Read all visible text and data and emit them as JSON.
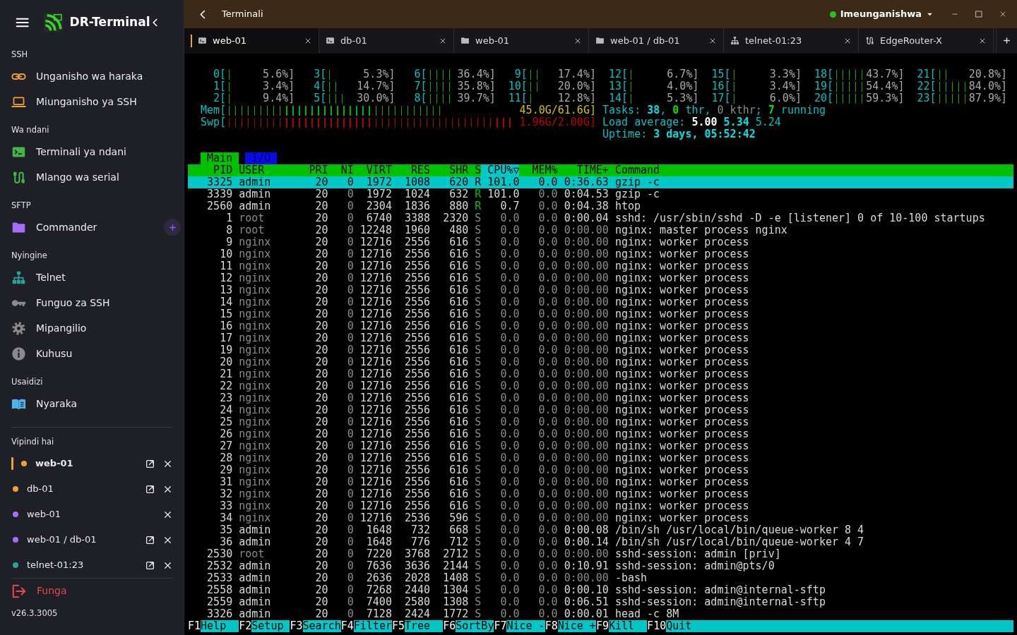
{
  "app": {
    "title": "DR-Terminal",
    "version": "v26.3.3005"
  },
  "sidebar": {
    "sections": [
      {
        "heading": "SSH",
        "items": [
          {
            "label": "Unganisho wa haraka",
            "addable": false
          },
          {
            "label": "Miunganisho ya SSH",
            "addable": false
          }
        ]
      },
      {
        "heading": "Wa ndani",
        "items": [
          {
            "label": "Terminali ya ndani",
            "addable": false
          },
          {
            "label": "Mlango wa serial",
            "addable": false
          }
        ]
      },
      {
        "heading": "SFTP",
        "items": [
          {
            "label": "Commander",
            "addable": true
          }
        ]
      },
      {
        "heading": "Nyingine",
        "items": [
          {
            "label": "Telnet",
            "addable": false
          },
          {
            "label": "Funguo za SSH",
            "addable": false
          },
          {
            "label": "Mipangilio",
            "addable": false
          },
          {
            "label": "Kuhusu",
            "addable": false
          }
        ]
      },
      {
        "heading": "Usaidizi",
        "items": [
          {
            "label": "Nyaraka",
            "addable": false
          }
        ]
      }
    ],
    "sessions_heading": "Vipindi hai",
    "sessions": [
      {
        "label": "web-01",
        "color": "#f0a030",
        "selected": true,
        "detachable": true
      },
      {
        "label": "db-01",
        "color": "#f0a030",
        "selected": false,
        "detachable": true
      },
      {
        "label": "web-01",
        "color": "#a66cff",
        "selected": false,
        "detachable": false
      },
      {
        "label": "web-01 / db-01",
        "color": "#a66cff",
        "selected": false,
        "detachable": true
      },
      {
        "label": "telnet-01:23",
        "color": "#26a69a",
        "selected": false,
        "detachable": true
      }
    ],
    "logout": "Funga"
  },
  "topbar": {
    "title": "Terminali",
    "status": "Imeunganishwa",
    "connected": true
  },
  "tabs": [
    {
      "label": "web-01",
      "selected": true
    },
    {
      "label": "db-01",
      "selected": false
    },
    {
      "label": "web-01",
      "selected": false
    },
    {
      "label": "web-01 / db-01",
      "selected": false
    },
    {
      "label": "telnet-01:23",
      "selected": false
    },
    {
      "label": "EdgeRouter-X",
      "selected": false
    }
  ],
  "terminal": {
    "meter_rows": [
      [
        {
          "label": "0[",
          "reading": "5.6%]"
        },
        {
          "label": "3[",
          "reading": "5.3%]"
        },
        {
          "label": "6[",
          "reading": "36.4%]"
        },
        {
          "label": "9[",
          "reading": "17.4%]"
        },
        {
          "label": "12[",
          "reading": "6.7%]"
        },
        {
          "label": "15[",
          "reading": "3.3%]"
        },
        {
          "label": "18[",
          "reading": "43.7%]"
        },
        {
          "label": "21[",
          "reading": "20.8%]"
        }
      ],
      [
        {
          "label": "1[",
          "reading": "3.4%]"
        },
        {
          "label": "4[",
          "reading": "14.7%]"
        },
        {
          "label": "7[",
          "reading": "35.8%]"
        },
        {
          "label": "10[",
          "reading": "20.0%]"
        },
        {
          "label": "13[",
          "reading": "4.0%]"
        },
        {
          "label": "16[",
          "reading": "3.4%]"
        },
        {
          "label": "19[",
          "reading": "54.4%]"
        },
        {
          "label": "22[",
          "reading": "84.0%]"
        }
      ],
      [
        {
          "label": "2[",
          "reading": "9.4%]"
        },
        {
          "label": "5[",
          "reading": "30.0%]"
        },
        {
          "label": "8[",
          "reading": "39.7%]"
        },
        {
          "label": "11[",
          "reading": "12.8%]"
        },
        {
          "label": "14[",
          "reading": "5.3%]"
        },
        {
          "label": "17[",
          "reading": "6.0%]"
        },
        {
          "label": "20[",
          "reading": "59.3%]"
        },
        {
          "label": "23[",
          "reading": "87.9%]"
        }
      ]
    ],
    "memory_meters": [
      {
        "kind": "mem",
        "label": "Mem[",
        "reading": "45.0G/61.6G]"
      },
      {
        "kind": "swap",
        "label": "Swp[",
        "reading": "1.96G/2.00G]"
      }
    ],
    "summary": [
      [
        {
          "kind": "label",
          "text": "Tasks: "
        },
        {
          "kind": "strong",
          "text": "38"
        },
        {
          "kind": "label",
          "text": ", "
        },
        {
          "kind": "good",
          "text": "0"
        },
        {
          "kind": "label",
          "text": " thr, "
        },
        {
          "kind": "dim",
          "text": "0 kthr"
        },
        {
          "kind": "label",
          "text": "; "
        },
        {
          "kind": "good",
          "text": "7"
        },
        {
          "kind": "label",
          "text": " running"
        }
      ],
      [
        {
          "kind": "label",
          "text": "Load average: "
        },
        {
          "kind": "bright",
          "text": "5.00"
        },
        {
          "kind": "strong",
          "text": " 5.34"
        },
        {
          "kind": "label",
          "text": " 5.24"
        }
      ],
      [
        {
          "kind": "label",
          "text": "Uptime: "
        },
        {
          "kind": "strong",
          "text": "3 days, 05:52:42"
        }
      ]
    ],
    "screen_tabs": [
      {
        "label": "Main",
        "selected": true
      },
      {
        "label": "I/O",
        "selected": false
      }
    ],
    "columns": [
      {
        "label": "PID",
        "sorted": false
      },
      {
        "label": "USER",
        "sorted": false
      },
      {
        "label": "PRI",
        "sorted": false
      },
      {
        "label": "NI",
        "sorted": false
      },
      {
        "label": "VIRT",
        "sorted": false
      },
      {
        "label": "RES",
        "sorted": false
      },
      {
        "label": "SHR",
        "sorted": false
      },
      {
        "label": "S",
        "sorted": false
      },
      {
        "label": "CPU%▽",
        "sorted": true
      },
      {
        "label": "MEM%",
        "sorted": false
      },
      {
        "label": "TIME+",
        "sorted": false
      },
      {
        "label": "Command",
        "sorted": false
      }
    ],
    "rows": [
      {
        "selected": true,
        "running": true,
        "dimmed": false,
        "cells": [
          "3325",
          "admin",
          "20",
          "0",
          "1972",
          "1008",
          "620",
          "R",
          "101.0",
          "0.0",
          "0:36.63",
          "gzip -c"
        ]
      },
      {
        "selected": false,
        "running": true,
        "dimmed": false,
        "cells": [
          "3339",
          "admin",
          "20",
          "0",
          "1972",
          "1024",
          "632",
          "R",
          "101.0",
          "0.0",
          "0:04.53",
          "gzip -c"
        ]
      },
      {
        "selected": false,
        "running": true,
        "dimmed": false,
        "cells": [
          "2560",
          "admin",
          "20",
          "0",
          "2304",
          "1836",
          "880",
          "R",
          "0.7",
          "0.0",
          "0:04.38",
          "htop"
        ]
      },
      {
        "selected": false,
        "running": false,
        "dimmed": true,
        "cells": [
          "1",
          "root",
          "20",
          "0",
          "6740",
          "3388",
          "2320",
          "S",
          "0.0",
          "0.0",
          "0:00.04",
          "sshd: /usr/sbin/sshd -D -e [listener] 0 of 10-100 startups"
        ]
      },
      {
        "selected": false,
        "running": false,
        "dimmed": true,
        "cells": [
          "8",
          "root",
          "20",
          "0",
          "12248",
          "1960",
          "480",
          "S",
          "0.0",
          "0.0",
          "0:00.00",
          "nginx: master process nginx"
        ]
      },
      {
        "selected": false,
        "running": false,
        "dimmed": true,
        "cells": [
          "9",
          "nginx",
          "20",
          "0",
          "12716",
          "2556",
          "616",
          "S",
          "0.0",
          "0.0",
          "0:00.00",
          "nginx: worker process"
        ]
      },
      {
        "selected": false,
        "running": false,
        "dimmed": true,
        "cells": [
          "10",
          "nginx",
          "20",
          "0",
          "12716",
          "2556",
          "616",
          "S",
          "0.0",
          "0.0",
          "0:00.00",
          "nginx: worker process"
        ]
      },
      {
        "selected": false,
        "running": false,
        "dimmed": true,
        "cells": [
          "11",
          "nginx",
          "20",
          "0",
          "12716",
          "2556",
          "616",
          "S",
          "0.0",
          "0.0",
          "0:00.00",
          "nginx: worker process"
        ]
      },
      {
        "selected": false,
        "running": false,
        "dimmed": true,
        "cells": [
          "12",
          "nginx",
          "20",
          "0",
          "12716",
          "2556",
          "616",
          "S",
          "0.0",
          "0.0",
          "0:00.00",
          "nginx: worker process"
        ]
      },
      {
        "selected": false,
        "running": false,
        "dimmed": true,
        "cells": [
          "13",
          "nginx",
          "20",
          "0",
          "12716",
          "2556",
          "616",
          "S",
          "0.0",
          "0.0",
          "0:00.00",
          "nginx: worker process"
        ]
      },
      {
        "selected": false,
        "running": false,
        "dimmed": true,
        "cells": [
          "14",
          "nginx",
          "20",
          "0",
          "12716",
          "2556",
          "616",
          "S",
          "0.0",
          "0.0",
          "0:00.00",
          "nginx: worker process"
        ]
      },
      {
        "selected": false,
        "running": false,
        "dimmed": true,
        "cells": [
          "15",
          "nginx",
          "20",
          "0",
          "12716",
          "2556",
          "616",
          "S",
          "0.0",
          "0.0",
          "0:00.00",
          "nginx: worker process"
        ]
      },
      {
        "selected": false,
        "running": false,
        "dimmed": true,
        "cells": [
          "16",
          "nginx",
          "20",
          "0",
          "12716",
          "2556",
          "616",
          "S",
          "0.0",
          "0.0",
          "0:00.00",
          "nginx: worker process"
        ]
      },
      {
        "selected": false,
        "running": false,
        "dimmed": true,
        "cells": [
          "17",
          "nginx",
          "20",
          "0",
          "12716",
          "2556",
          "616",
          "S",
          "0.0",
          "0.0",
          "0:00.00",
          "nginx: worker process"
        ]
      },
      {
        "selected": false,
        "running": false,
        "dimmed": true,
        "cells": [
          "19",
          "nginx",
          "20",
          "0",
          "12716",
          "2556",
          "616",
          "S",
          "0.0",
          "0.0",
          "0:00.00",
          "nginx: worker process"
        ]
      },
      {
        "selected": false,
        "running": false,
        "dimmed": true,
        "cells": [
          "20",
          "nginx",
          "20",
          "0",
          "12716",
          "2556",
          "616",
          "S",
          "0.0",
          "0.0",
          "0:00.00",
          "nginx: worker process"
        ]
      },
      {
        "selected": false,
        "running": false,
        "dimmed": true,
        "cells": [
          "21",
          "nginx",
          "20",
          "0",
          "12716",
          "2556",
          "616",
          "S",
          "0.0",
          "0.0",
          "0:00.00",
          "nginx: worker process"
        ]
      },
      {
        "selected": false,
        "running": false,
        "dimmed": true,
        "cells": [
          "22",
          "nginx",
          "20",
          "0",
          "12716",
          "2556",
          "616",
          "S",
          "0.0",
          "0.0",
          "0:00.00",
          "nginx: worker process"
        ]
      },
      {
        "selected": false,
        "running": false,
        "dimmed": true,
        "cells": [
          "23",
          "nginx",
          "20",
          "0",
          "12716",
          "2556",
          "616",
          "S",
          "0.0",
          "0.0",
          "0:00.00",
          "nginx: worker process"
        ]
      },
      {
        "selected": false,
        "running": false,
        "dimmed": true,
        "cells": [
          "24",
          "nginx",
          "20",
          "0",
          "12716",
          "2556",
          "616",
          "S",
          "0.0",
          "0.0",
          "0:00.00",
          "nginx: worker process"
        ]
      },
      {
        "selected": false,
        "running": false,
        "dimmed": true,
        "cells": [
          "25",
          "nginx",
          "20",
          "0",
          "12716",
          "2556",
          "616",
          "S",
          "0.0",
          "0.0",
          "0:00.00",
          "nginx: worker process"
        ]
      },
      {
        "selected": false,
        "running": false,
        "dimmed": true,
        "cells": [
          "26",
          "nginx",
          "20",
          "0",
          "12716",
          "2556",
          "616",
          "S",
          "0.0",
          "0.0",
          "0:00.00",
          "nginx: worker process"
        ]
      },
      {
        "selected": false,
        "running": false,
        "dimmed": true,
        "cells": [
          "27",
          "nginx",
          "20",
          "0",
          "12716",
          "2556",
          "616",
          "S",
          "0.0",
          "0.0",
          "0:00.00",
          "nginx: worker process"
        ]
      },
      {
        "selected": false,
        "running": false,
        "dimmed": true,
        "cells": [
          "28",
          "nginx",
          "20",
          "0",
          "12716",
          "2556",
          "616",
          "S",
          "0.0",
          "0.0",
          "0:00.00",
          "nginx: worker process"
        ]
      },
      {
        "selected": false,
        "running": false,
        "dimmed": true,
        "cells": [
          "29",
          "nginx",
          "20",
          "0",
          "12716",
          "2556",
          "616",
          "S",
          "0.0",
          "0.0",
          "0:00.00",
          "nginx: worker process"
        ]
      },
      {
        "selected": false,
        "running": false,
        "dimmed": true,
        "cells": [
          "31",
          "nginx",
          "20",
          "0",
          "12716",
          "2556",
          "616",
          "S",
          "0.0",
          "0.0",
          "0:00.00",
          "nginx: worker process"
        ]
      },
      {
        "selected": false,
        "running": false,
        "dimmed": true,
        "cells": [
          "32",
          "nginx",
          "20",
          "0",
          "12716",
          "2556",
          "616",
          "S",
          "0.0",
          "0.0",
          "0:00.00",
          "nginx: worker process"
        ]
      },
      {
        "selected": false,
        "running": false,
        "dimmed": true,
        "cells": [
          "33",
          "nginx",
          "20",
          "0",
          "12716",
          "2556",
          "616",
          "S",
          "0.0",
          "0.0",
          "0:00.00",
          "nginx: worker process"
        ]
      },
      {
        "selected": false,
        "running": false,
        "dimmed": true,
        "cells": [
          "34",
          "nginx",
          "20",
          "0",
          "12716",
          "2536",
          "596",
          "S",
          "0.0",
          "0.0",
          "0:00.00",
          "nginx: worker process"
        ]
      },
      {
        "selected": false,
        "running": false,
        "dimmed": false,
        "cells": [
          "35",
          "admin",
          "20",
          "0",
          "1648",
          "732",
          "668",
          "S",
          "0.0",
          "0.0",
          "0:00.08",
          "/bin/sh /usr/local/bin/queue-worker 8 4"
        ]
      },
      {
        "selected": false,
        "running": false,
        "dimmed": false,
        "cells": [
          "36",
          "admin",
          "20",
          "0",
          "1648",
          "776",
          "712",
          "S",
          "0.0",
          "0.0",
          "0:00.14",
          "/bin/sh /usr/local/bin/queue-worker 4 7"
        ]
      },
      {
        "selected": false,
        "running": false,
        "dimmed": true,
        "cells": [
          "2530",
          "root",
          "20",
          "0",
          "7220",
          "3768",
          "2712",
          "S",
          "0.0",
          "0.0",
          "0:00.00",
          "sshd-session: admin [priv]"
        ]
      },
      {
        "selected": false,
        "running": false,
        "dimmed": false,
        "cells": [
          "2532",
          "admin",
          "20",
          "0",
          "7636",
          "3636",
          "2144",
          "S",
          "0.0",
          "0.0",
          "0:10.91",
          "sshd-session: admin@pts/0"
        ]
      },
      {
        "selected": false,
        "running": false,
        "dimmed": false,
        "cells": [
          "2533",
          "admin",
          "20",
          "0",
          "2636",
          "2028",
          "1408",
          "S",
          "0.0",
          "0.0",
          "0:00.00",
          "-bash"
        ]
      },
      {
        "selected": false,
        "running": false,
        "dimmed": false,
        "cells": [
          "2558",
          "admin",
          "20",
          "0",
          "7268",
          "2440",
          "1304",
          "S",
          "0.0",
          "0.0",
          "0:00.10",
          "sshd-session: admin@internal-sftp"
        ]
      },
      {
        "selected": false,
        "running": false,
        "dimmed": false,
        "cells": [
          "2559",
          "admin",
          "20",
          "0",
          "7400",
          "2580",
          "1308",
          "S",
          "0.0",
          "0.0",
          "0:06.51",
          "sshd-session: admin@internal-sftp"
        ]
      },
      {
        "selected": false,
        "running": false,
        "dimmed": false,
        "cells": [
          "3326",
          "admin",
          "20",
          "0",
          "7128",
          "2424",
          "1772",
          "S",
          "0.0",
          "0.0",
          "0:00.01",
          "head -c 8M"
        ]
      }
    ],
    "function_keys": [
      {
        "key": "F1",
        "label": "Help"
      },
      {
        "key": "F2",
        "label": "Setup"
      },
      {
        "key": "F3",
        "label": "Search"
      },
      {
        "key": "F4",
        "label": "Filter"
      },
      {
        "key": "F5",
        "label": "Tree"
      },
      {
        "key": "F6",
        "label": "SortBy"
      },
      {
        "key": "F7",
        "label": "Nice -"
      },
      {
        "key": "F8",
        "label": "Nice +"
      },
      {
        "key": "F9",
        "label": "Kill"
      },
      {
        "key": "F10",
        "label": "Quit"
      }
    ]
  }
}
